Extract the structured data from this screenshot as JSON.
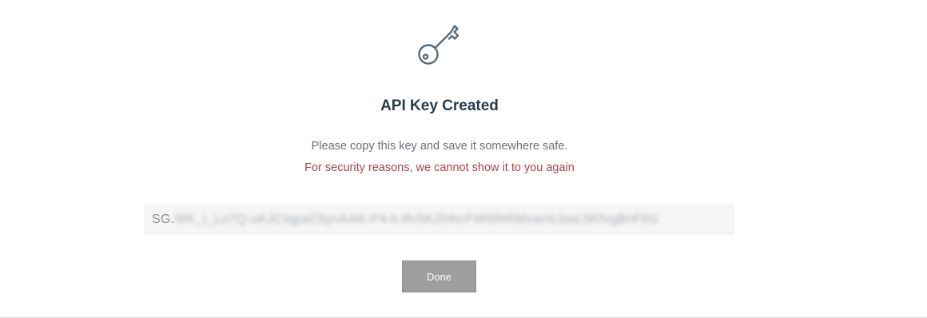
{
  "dialog": {
    "icon": "key-icon",
    "title": "API Key Created",
    "instruction": "Please copy this key and save it somewhere safe.",
    "warning": "For security reasons, we cannot show it to you again",
    "api_key": {
      "visible_prefix": "SG.",
      "obscured_value": "WK_I_Lo7Q-uKJCIqpaC5ynAAK-P4-k-tfvSKZHhcFWWhRMxarnLbwL5KfvgBnF5G"
    },
    "done_label": "Done"
  },
  "colors": {
    "title": "#2a3b4d",
    "instruction": "#6b6f74",
    "warning": "#a94442",
    "key_box_background": "#f5f5f5",
    "done_button_background": "#9e9e9e",
    "icon_stroke": "#5a6b7e"
  }
}
